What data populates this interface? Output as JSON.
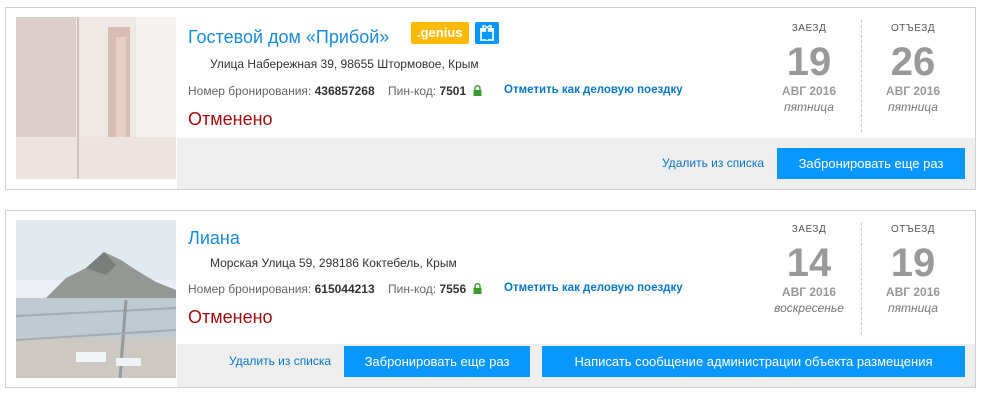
{
  "bookings": [
    {
      "hotel_name": "Гостевой дом «Прибой»",
      "genius_label": ".genius",
      "address": "Улица Набережная 39, 98655 Штормовое, Крым",
      "booking_number_label": "Номер бронирования:",
      "booking_number": "436857268",
      "pin_label": "Пин-код:",
      "pin": "7501",
      "business_trip_link": "Отметить как деловую поездку",
      "status": "Отменено",
      "checkin": {
        "caption": "ЗАЕЗД",
        "day": "19",
        "month_year": "АВГ 2016",
        "weekday": "пятница"
      },
      "checkout": {
        "caption": "ОТЪЕЗД",
        "day": "26",
        "month_year": "АВГ 2016",
        "weekday": "пятница"
      },
      "remove_link": "Удалить из списка",
      "rebook_button": "Забронировать еще раз"
    },
    {
      "hotel_name": "Лиана",
      "address": "Морская Улица 59, 298186 Коктебель, Крым",
      "booking_number_label": "Номер бронирования:",
      "booking_number": "615044213",
      "pin_label": "Пин-код:",
      "pin": "7556",
      "business_trip_link": "Отметить как деловую поездку",
      "status": "Отменено",
      "checkin": {
        "caption": "ЗАЕЗД",
        "day": "14",
        "month_year": "АВГ 2016",
        "weekday": "воскресенье"
      },
      "checkout": {
        "caption": "ОТЪЕЗД",
        "day": "19",
        "month_year": "АВГ 2016",
        "weekday": "пятница"
      },
      "remove_link": "Удалить из списка",
      "rebook_button": "Забронировать еще раз",
      "message_button": "Написать сообщение администрации объекта размещения"
    }
  ],
  "colors": {
    "link": "#1a8bd9",
    "button": "#0896ff",
    "status_cancelled": "#9e0b0f",
    "genius": "#febb02"
  }
}
